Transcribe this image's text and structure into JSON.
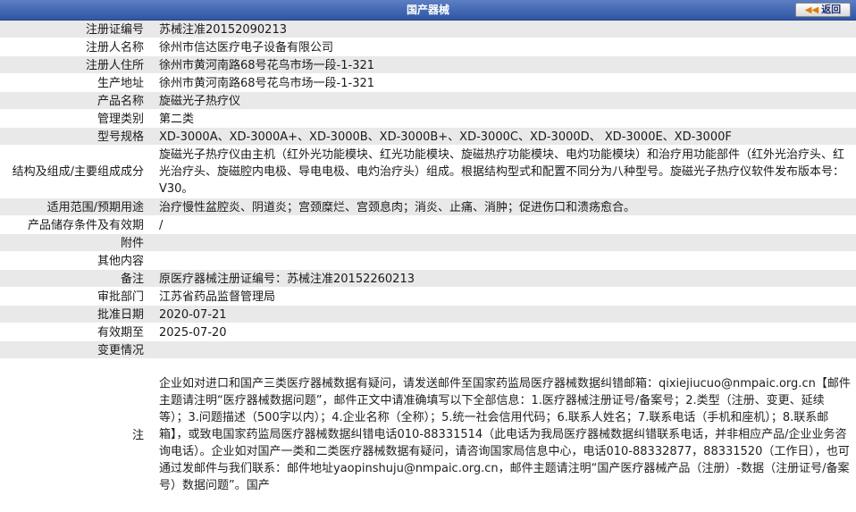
{
  "header": {
    "title": "国产器械",
    "back_label": "返回"
  },
  "rows": [
    {
      "label": "注册证编号",
      "value": "苏械注准20152090213"
    },
    {
      "label": "注册人名称",
      "value": "徐州市信达医疗电子设备有限公司"
    },
    {
      "label": "注册人住所",
      "value": "徐州市黄河南路68号花鸟市场一段-1-321"
    },
    {
      "label": "生产地址",
      "value": "徐州市黄河南路68号花鸟市场一段-1-321"
    },
    {
      "label": "产品名称",
      "value": "旋磁光子热疗仪"
    },
    {
      "label": "管理类别",
      "value": "第二类"
    },
    {
      "label": "型号规格",
      "value": "XD-3000A、XD-3000A+、XD-3000B、XD-3000B+、XD-3000C、XD-3000D、 XD-3000E、XD-3000F"
    },
    {
      "label": "结构及组成/主要组成成分",
      "value": "旋磁光子热疗仪由主机（红外光功能模块、红光功能模块、旋磁热疗功能模块、电灼功能模块）和治疗用功能部件（红外光治疗头、红光治疗头、旋磁腔内电极、导电电极、电灼治疗头）组成。根据结构型式和配置不同分为八种型号。旋磁光子热疗仪软件发布版本号：V30。"
    },
    {
      "label": "适用范围/预期用途",
      "value": "治疗慢性盆腔炎、阴道炎；宫颈糜烂、宫颈息肉；消炎、止痛、消肿；促进伤口和溃疡愈合。"
    },
    {
      "label": "产品储存条件及有效期",
      "value": "/"
    },
    {
      "label": "附件",
      "value": ""
    },
    {
      "label": "其他内容",
      "value": ""
    },
    {
      "label": "备注",
      "value": "原医疗器械注册证编号：苏械注准20152260213"
    },
    {
      "label": "审批部门",
      "value": "江苏省药品监督管理局"
    },
    {
      "label": "批准日期",
      "value": "2020-07-21"
    },
    {
      "label": "有效期至",
      "value": "2025-07-20"
    },
    {
      "label": "变更情况",
      "value": ""
    }
  ],
  "note": {
    "label": "注",
    "text": "企业如对进口和国产三类医疗器械数据有疑问，请发送邮件至国家药监局医疗器械数据纠错邮箱：qixiejiucuo@nmpaic.org.cn【邮件主题请注明“医疗器械数据问题”，邮件正文中请准确填写以下全部信息：1.医疗器械注册证号/备案号；2.类型（注册、变更、延续等）；3.问题描述（500字以内）；4.企业名称（全称）；5.统一社会信用代码；6.联系人姓名；7.联系电话（手机和座机）；8.联系邮箱】，或致电国家药监局医疗器械数据纠错电话010-88331514（此电话为我局医疗器械数据纠错联系电话，并非相应产品/企业业务咨询电话）。企业如对国产一类和二类医疗器械数据有疑问，请咨询国家局信息中心，电话010-88332877，88331520（工作日），也可通过发邮件与我们联系：邮件地址yaopinshuju@nmpaic.org.cn，邮件主题请注明“国产医疗器械产品（注册）-数据（注册证号/备案号）数据问题”。国产"
  }
}
